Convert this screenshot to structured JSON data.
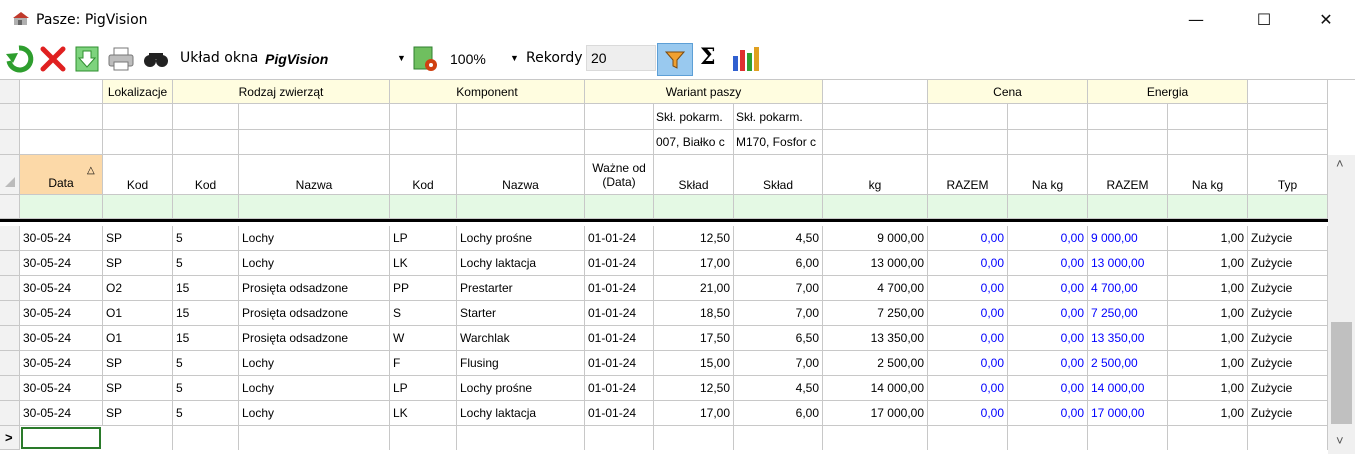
{
  "window": {
    "title": "Pasze: PigVision",
    "minimize": "—",
    "maximize": "☐",
    "close": "✕"
  },
  "toolbar": {
    "uklad_label": "Układ okna",
    "uklad_value": "PigVision",
    "zoom_value": "100%",
    "rekordy_label": "Rekordy",
    "rekordy_value": "20",
    "sigma": "Σ",
    "icons": [
      "refresh-icon",
      "delete-icon",
      "download-icon",
      "print-icon",
      "search-icon",
      "layout-settings-icon",
      "filter-icon",
      "sum-icon",
      "chart-icon"
    ]
  },
  "grid": {
    "bands": {
      "lokalizacje": "Lokalizacje",
      "rodzaj": "Rodzaj zwierząt",
      "komponent": "Komponent",
      "wariant": "Wariant paszy",
      "cena": "Cena",
      "energia": "Energia"
    },
    "sub1": {
      "skl1": "Skł. pokarm.",
      "skl2": "Skł. pokarm."
    },
    "sub2": {
      "skl1": "007, Białko c",
      "skl2": "M170, Fosfor c"
    },
    "headers": {
      "data": "Data",
      "sort_indicator": "△",
      "lok_kod": "Kod",
      "rz_kod": "Kod",
      "rz_nazwa": "Nazwa",
      "k_kod": "Kod",
      "k_nazwa": "Nazwa",
      "wazne": "Ważne od (Data)",
      "sklad1": "Skład",
      "sklad2": "Skład",
      "kg": "kg",
      "cena_razem": "RAZEM",
      "cena_nakg": "Na kg",
      "en_razem": "RAZEM",
      "en_nakg": "Na kg",
      "typ": "Typ"
    },
    "new_row_marker": ">",
    "rows": [
      [
        "30-05-24",
        "SP",
        "5",
        "Lochy",
        "LP",
        "Lochy prośne",
        "01-01-24",
        "12,50",
        "4,50",
        "9 000,00",
        "0,00",
        "0,00",
        "9 000,00",
        "1,00",
        "Zużycie"
      ],
      [
        "30-05-24",
        "SP",
        "5",
        "Lochy",
        "LK",
        "Lochy laktacja",
        "01-01-24",
        "17,00",
        "6,00",
        "13 000,00",
        "0,00",
        "0,00",
        "13 000,00",
        "1,00",
        "Zużycie"
      ],
      [
        "30-05-24",
        "O2",
        "15",
        "Prosięta odsadzone",
        "PP",
        "Prestarter",
        "01-01-24",
        "21,00",
        "7,00",
        "4 700,00",
        "0,00",
        "0,00",
        "4 700,00",
        "1,00",
        "Zużycie"
      ],
      [
        "30-05-24",
        "O1",
        "15",
        "Prosięta odsadzone",
        "S",
        "Starter",
        "01-01-24",
        "18,50",
        "7,00",
        "7 250,00",
        "0,00",
        "0,00",
        "7 250,00",
        "1,00",
        "Zużycie"
      ],
      [
        "30-05-24",
        "O1",
        "15",
        "Prosięta odsadzone",
        "W",
        "Warchlak",
        "01-01-24",
        "17,50",
        "6,50",
        "13 350,00",
        "0,00",
        "0,00",
        "13 350,00",
        "1,00",
        "Zużycie"
      ],
      [
        "30-05-24",
        "SP",
        "5",
        "Lochy",
        "F",
        "Flusing",
        "01-01-24",
        "15,00",
        "7,00",
        "2 500,00",
        "0,00",
        "0,00",
        "2 500,00",
        "1,00",
        "Zużycie"
      ],
      [
        "30-05-24",
        "SP",
        "5",
        "Lochy",
        "LP",
        "Lochy prośne",
        "01-01-24",
        "12,50",
        "4,50",
        "14 000,00",
        "0,00",
        "0,00",
        "14 000,00",
        "1,00",
        "Zużycie"
      ],
      [
        "30-05-24",
        "SP",
        "5",
        "Lochy",
        "LK",
        "Lochy laktacja",
        "01-01-24",
        "17,00",
        "6,00",
        "17 000,00",
        "0,00",
        "0,00",
        "17 000,00",
        "1,00",
        "Zużycie"
      ]
    ]
  },
  "colors": {
    "band": "#fffde0",
    "filter_row": "#e4f9e4",
    "sorted_header": "#fcd9a8",
    "blue_values": "#0000ff",
    "filter_active": "#99c9ef"
  }
}
